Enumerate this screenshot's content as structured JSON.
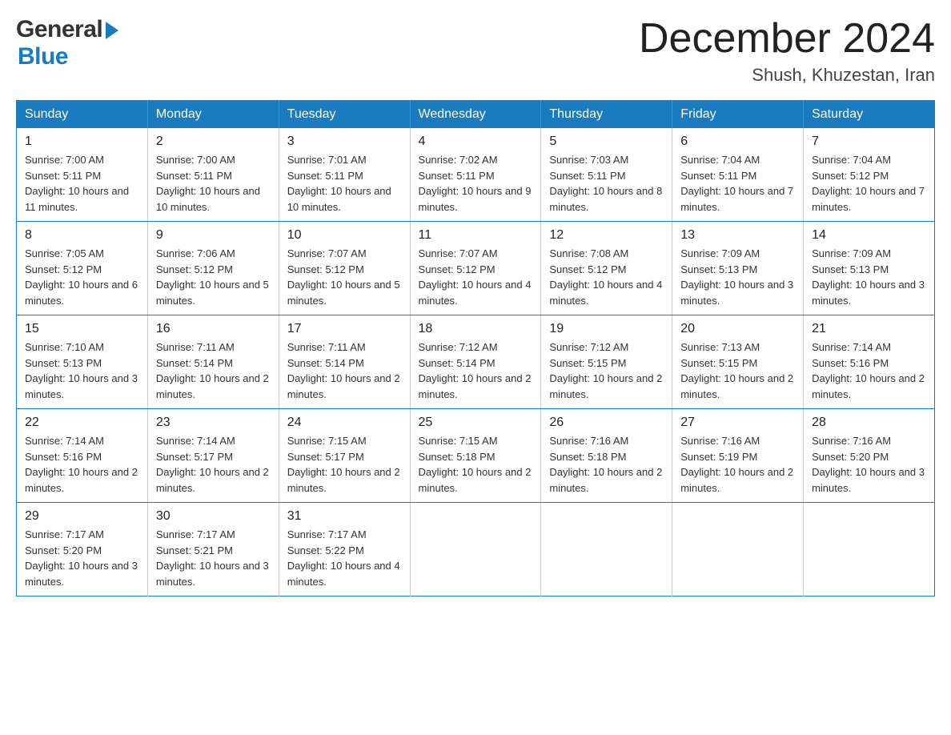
{
  "header": {
    "logo_general": "General",
    "logo_blue": "Blue",
    "month_title": "December 2024",
    "location": "Shush, Khuzestan, Iran"
  },
  "calendar": {
    "days_of_week": [
      "Sunday",
      "Monday",
      "Tuesday",
      "Wednesday",
      "Thursday",
      "Friday",
      "Saturday"
    ],
    "weeks": [
      [
        {
          "day": "1",
          "sunrise": "7:00 AM",
          "sunset": "5:11 PM",
          "daylight": "10 hours and 11 minutes."
        },
        {
          "day": "2",
          "sunrise": "7:00 AM",
          "sunset": "5:11 PM",
          "daylight": "10 hours and 10 minutes."
        },
        {
          "day": "3",
          "sunrise": "7:01 AM",
          "sunset": "5:11 PM",
          "daylight": "10 hours and 10 minutes."
        },
        {
          "day": "4",
          "sunrise": "7:02 AM",
          "sunset": "5:11 PM",
          "daylight": "10 hours and 9 minutes."
        },
        {
          "day": "5",
          "sunrise": "7:03 AM",
          "sunset": "5:11 PM",
          "daylight": "10 hours and 8 minutes."
        },
        {
          "day": "6",
          "sunrise": "7:04 AM",
          "sunset": "5:11 PM",
          "daylight": "10 hours and 7 minutes."
        },
        {
          "day": "7",
          "sunrise": "7:04 AM",
          "sunset": "5:12 PM",
          "daylight": "10 hours and 7 minutes."
        }
      ],
      [
        {
          "day": "8",
          "sunrise": "7:05 AM",
          "sunset": "5:12 PM",
          "daylight": "10 hours and 6 minutes."
        },
        {
          "day": "9",
          "sunrise": "7:06 AM",
          "sunset": "5:12 PM",
          "daylight": "10 hours and 5 minutes."
        },
        {
          "day": "10",
          "sunrise": "7:07 AM",
          "sunset": "5:12 PM",
          "daylight": "10 hours and 5 minutes."
        },
        {
          "day": "11",
          "sunrise": "7:07 AM",
          "sunset": "5:12 PM",
          "daylight": "10 hours and 4 minutes."
        },
        {
          "day": "12",
          "sunrise": "7:08 AM",
          "sunset": "5:12 PM",
          "daylight": "10 hours and 4 minutes."
        },
        {
          "day": "13",
          "sunrise": "7:09 AM",
          "sunset": "5:13 PM",
          "daylight": "10 hours and 3 minutes."
        },
        {
          "day": "14",
          "sunrise": "7:09 AM",
          "sunset": "5:13 PM",
          "daylight": "10 hours and 3 minutes."
        }
      ],
      [
        {
          "day": "15",
          "sunrise": "7:10 AM",
          "sunset": "5:13 PM",
          "daylight": "10 hours and 3 minutes."
        },
        {
          "day": "16",
          "sunrise": "7:11 AM",
          "sunset": "5:14 PM",
          "daylight": "10 hours and 2 minutes."
        },
        {
          "day": "17",
          "sunrise": "7:11 AM",
          "sunset": "5:14 PM",
          "daylight": "10 hours and 2 minutes."
        },
        {
          "day": "18",
          "sunrise": "7:12 AM",
          "sunset": "5:14 PM",
          "daylight": "10 hours and 2 minutes."
        },
        {
          "day": "19",
          "sunrise": "7:12 AM",
          "sunset": "5:15 PM",
          "daylight": "10 hours and 2 minutes."
        },
        {
          "day": "20",
          "sunrise": "7:13 AM",
          "sunset": "5:15 PM",
          "daylight": "10 hours and 2 minutes."
        },
        {
          "day": "21",
          "sunrise": "7:14 AM",
          "sunset": "5:16 PM",
          "daylight": "10 hours and 2 minutes."
        }
      ],
      [
        {
          "day": "22",
          "sunrise": "7:14 AM",
          "sunset": "5:16 PM",
          "daylight": "10 hours and 2 minutes."
        },
        {
          "day": "23",
          "sunrise": "7:14 AM",
          "sunset": "5:17 PM",
          "daylight": "10 hours and 2 minutes."
        },
        {
          "day": "24",
          "sunrise": "7:15 AM",
          "sunset": "5:17 PM",
          "daylight": "10 hours and 2 minutes."
        },
        {
          "day": "25",
          "sunrise": "7:15 AM",
          "sunset": "5:18 PM",
          "daylight": "10 hours and 2 minutes."
        },
        {
          "day": "26",
          "sunrise": "7:16 AM",
          "sunset": "5:18 PM",
          "daylight": "10 hours and 2 minutes."
        },
        {
          "day": "27",
          "sunrise": "7:16 AM",
          "sunset": "5:19 PM",
          "daylight": "10 hours and 2 minutes."
        },
        {
          "day": "28",
          "sunrise": "7:16 AM",
          "sunset": "5:20 PM",
          "daylight": "10 hours and 3 minutes."
        }
      ],
      [
        {
          "day": "29",
          "sunrise": "7:17 AM",
          "sunset": "5:20 PM",
          "daylight": "10 hours and 3 minutes."
        },
        {
          "day": "30",
          "sunrise": "7:17 AM",
          "sunset": "5:21 PM",
          "daylight": "10 hours and 3 minutes."
        },
        {
          "day": "31",
          "sunrise": "7:17 AM",
          "sunset": "5:22 PM",
          "daylight": "10 hours and 4 minutes."
        },
        null,
        null,
        null,
        null
      ]
    ]
  }
}
